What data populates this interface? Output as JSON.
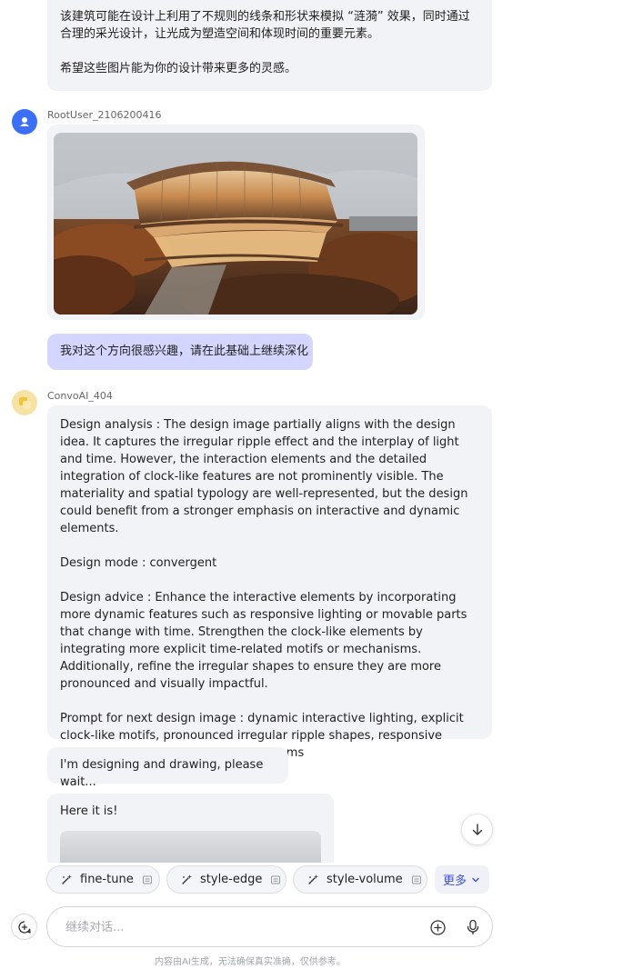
{
  "messages": {
    "top_ai": {
      "paragraph1": "该建筑可能在设计上利用了不规则的线条和形状来模拟 “涟漪” 效果，同时通过合理的采光设计，让光成为塑造空间和体现时间的重要元素。",
      "paragraph2": "希望这些图片能为你的设计带来更多的灵感。"
    },
    "user": {
      "username": "RootUser_2106200416",
      "image_alt": "Curved glass-facade building among autumn trees",
      "text": "我对这个方向很感兴趣，请在此基础上继续深化"
    },
    "ai": {
      "username": "ConvoAI_404",
      "analysis": "Design analysis : The design image partially aligns with the design idea. It captures the irregular ripple effect and the interplay of light and time. However, the interaction elements and the detailed integration of clock-like features are not prominently visible. The materiality and spatial typology are well-represented, but the design could benefit from a stronger emphasis on interactive and dynamic elements.",
      "mode": "Design mode : convergent",
      "advice": "Design advice : Enhance the interactive elements by incorporating more dynamic features such as responsive lighting or movable parts that change with time. Strengthen the clock-like elements by integrating more explicit time-related motifs or mechanisms. Additionally, refine the irregular shapes to ensure they are more pronounced and visually impactful.",
      "prompt": "Prompt for next design image : dynamic interactive lighting, explicit clock-like motifs, pronounced irregular ripple shapes, responsive movable parts, time-related mechanisms",
      "status": "I'm designing and drawing, please wait...",
      "result_label": "Here it is!"
    }
  },
  "chips": [
    {
      "label": "fine-tune",
      "icon": "sparkle-wand-icon",
      "tail_icon": "card-icon"
    },
    {
      "label": "style-edge",
      "icon": "sparkle-wand-icon",
      "tail_icon": "card-icon"
    },
    {
      "label": "style-volume",
      "icon": "sparkle-wand-icon",
      "tail_icon": "card-icon"
    }
  ],
  "more_label": "更多",
  "input": {
    "placeholder": "继续对话..."
  },
  "footer_note": "内容由AI生成，无法确保真实准确，仅供参考。",
  "colors": {
    "accent": "#3b52d9",
    "user_bubble": "#d4d6ff",
    "ai_bubble": "#f2f3f7",
    "user_avatar": "#3b6ff5",
    "ai_avatar": "#f6e2a5"
  }
}
